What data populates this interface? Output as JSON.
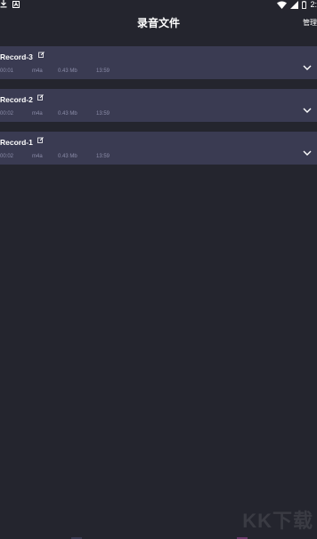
{
  "status_bar": {
    "left_icons": [
      "download-icon",
      "notification-a-icon"
    ],
    "right_icons": [
      "wifi-icon",
      "signal-icon",
      "battery-icon"
    ],
    "time": "2:"
  },
  "header": {
    "title": "录音文件",
    "manage_label": "管理"
  },
  "recordings": [
    {
      "name": "Record-3",
      "duration": "00:01",
      "format": "m4a",
      "size": "0.43 Mb",
      "time": "13:59",
      "edit_icon": "edit-icon",
      "expand_icon": "chevron-down-icon"
    },
    {
      "name": "Record-2",
      "duration": "00:02",
      "format": "m4a",
      "size": "0.43 Mb",
      "time": "13:59",
      "edit_icon": "edit-icon",
      "expand_icon": "chevron-down-icon"
    },
    {
      "name": "Record-1",
      "duration": "00:02",
      "format": "m4a",
      "size": "0.43 Mb",
      "time": "13:59",
      "edit_icon": "edit-icon",
      "expand_icon": "chevron-down-icon"
    }
  ],
  "watermark": "KK下载",
  "colors": {
    "background": "#24252e",
    "card": "#3a3b52",
    "meta_text": "#8b8ca8",
    "primary_text": "#ffffff"
  }
}
